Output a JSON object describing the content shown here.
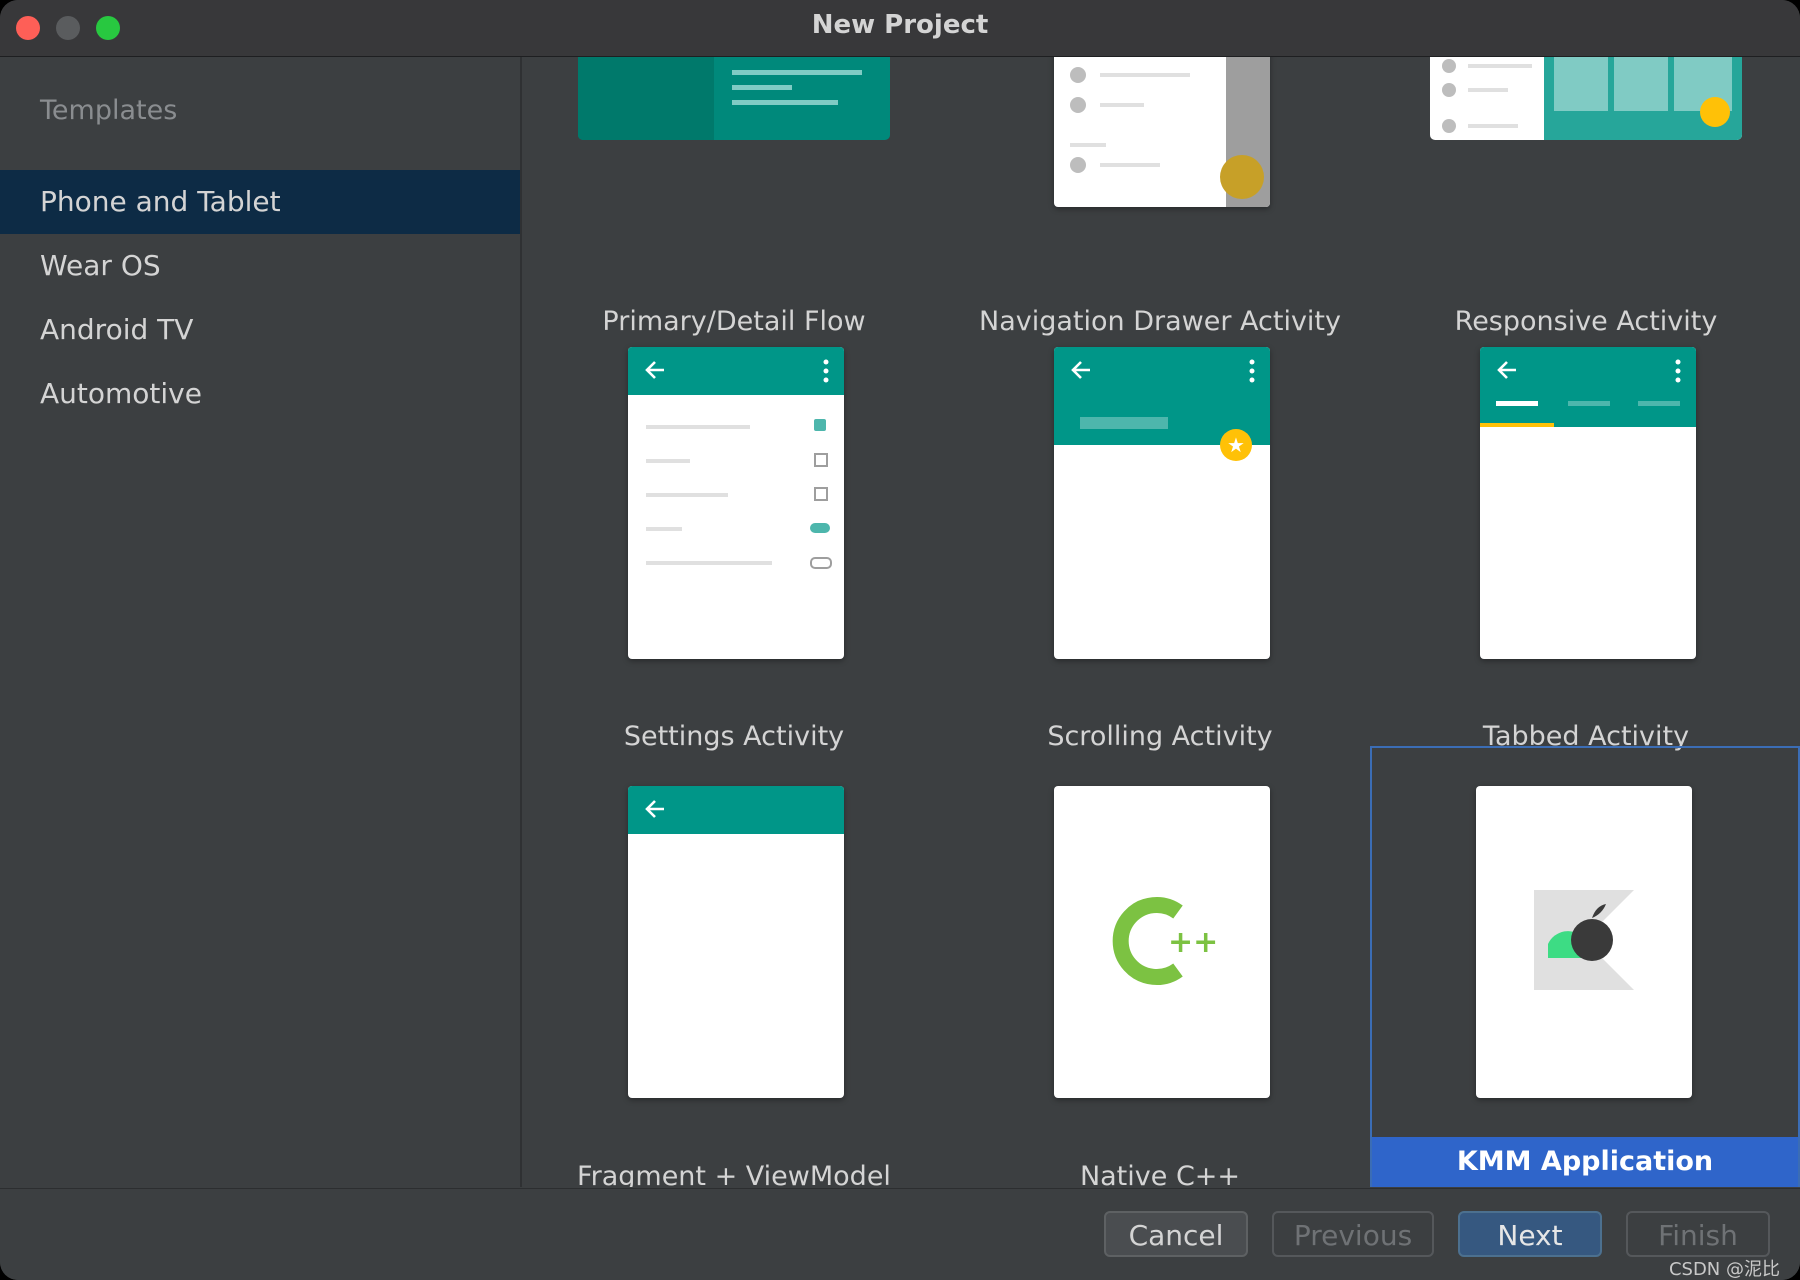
{
  "window": {
    "title": "New Project"
  },
  "sidebar": {
    "header": "Templates",
    "items": [
      {
        "label": "Phone and Tablet",
        "selected": true
      },
      {
        "label": "Wear OS",
        "selected": false
      },
      {
        "label": "Android TV",
        "selected": false
      },
      {
        "label": "Automotive",
        "selected": false
      }
    ]
  },
  "templates": [
    {
      "label": "Primary/Detail Flow",
      "icon": "primary-detail-preview"
    },
    {
      "label": "Navigation Drawer Activity",
      "icon": "nav-drawer-preview"
    },
    {
      "label": "Responsive Activity",
      "icon": "responsive-preview"
    },
    {
      "label": "Settings Activity",
      "icon": "settings-preview"
    },
    {
      "label": "Scrolling Activity",
      "icon": "scrolling-preview"
    },
    {
      "label": "Tabbed Activity",
      "icon": "tabbed-preview"
    },
    {
      "label": "Fragment + ViewModel",
      "icon": "fragment-preview"
    },
    {
      "label": "Native C++",
      "icon": "cpp-logo-icon"
    },
    {
      "label": "KMM Application",
      "icon": "kmm-logo-icon",
      "selected": true
    }
  ],
  "footer": {
    "cancel": "Cancel",
    "previous": "Previous",
    "next": "Next",
    "finish": "Finish"
  },
  "watermark": "CSDN @泥比",
  "colors": {
    "accent_teal": "#009688",
    "selection_blue": "#2f65ca",
    "sidebar_selected": "#0d2b45",
    "fab_yellow": "#ffc107"
  }
}
